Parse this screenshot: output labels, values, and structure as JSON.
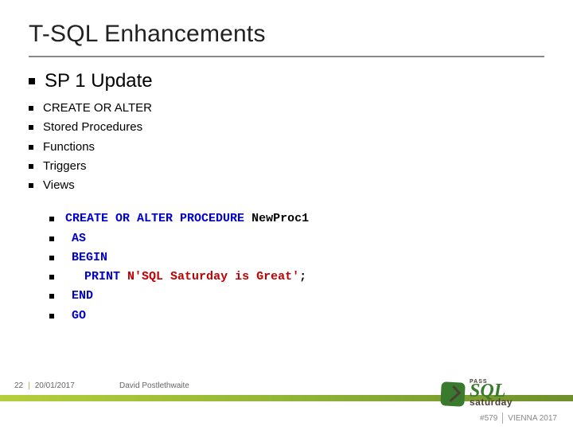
{
  "title": "T-SQL Enhancements",
  "heading": "SP 1 Update",
  "sub_heading": "CREATE OR ALTER",
  "items": [
    "Stored Procedures",
    "Functions",
    "Triggers",
    "Views"
  ],
  "code": {
    "line1_kw": "CREATE OR ALTER PROCEDURE",
    "line1_name": "NewProc1",
    "line2": "AS",
    "line3": "BEGIN",
    "line4_kw": "PRINT",
    "line4_kw2": "N",
    "line4_str": "'SQL Saturday is Great'",
    "line4_end": ";",
    "line5": "END",
    "line6": "GO"
  },
  "footer": {
    "page": "22",
    "sep": "|",
    "date": "20/01/2017",
    "author": "David Postlethwaite",
    "event_num": "#579",
    "event_loc": "VIENNA 2017"
  },
  "logo": {
    "pass": "PASS",
    "sql": "SQL",
    "sat": "saturday"
  }
}
